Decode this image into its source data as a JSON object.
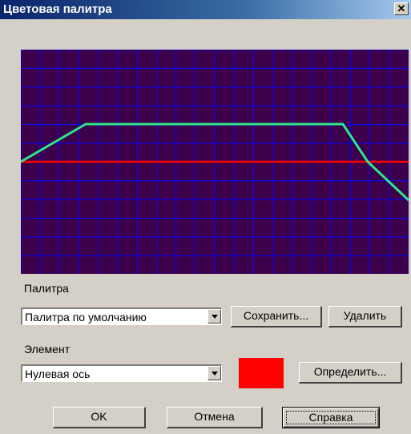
{
  "window": {
    "title": "Цветовая палитра",
    "close_glyph": "✕"
  },
  "palette_section": {
    "label": "Палитра",
    "select_value": "Палитра по умолчанию",
    "save_button": "Сохранить...",
    "delete_button": "Удалить"
  },
  "element_section": {
    "label": "Элемент",
    "select_value": "Нулевая ось",
    "color": "#ff0000",
    "define_button": "Определить..."
  },
  "buttons": {
    "ok": "OK",
    "cancel": "Отмена",
    "help": "Справка"
  },
  "graph": {
    "background_color": "#3d004a",
    "grid_color": "#0000ff",
    "zero_axis_color": "#ff0000",
    "curve_color": "#2ee68a"
  }
}
